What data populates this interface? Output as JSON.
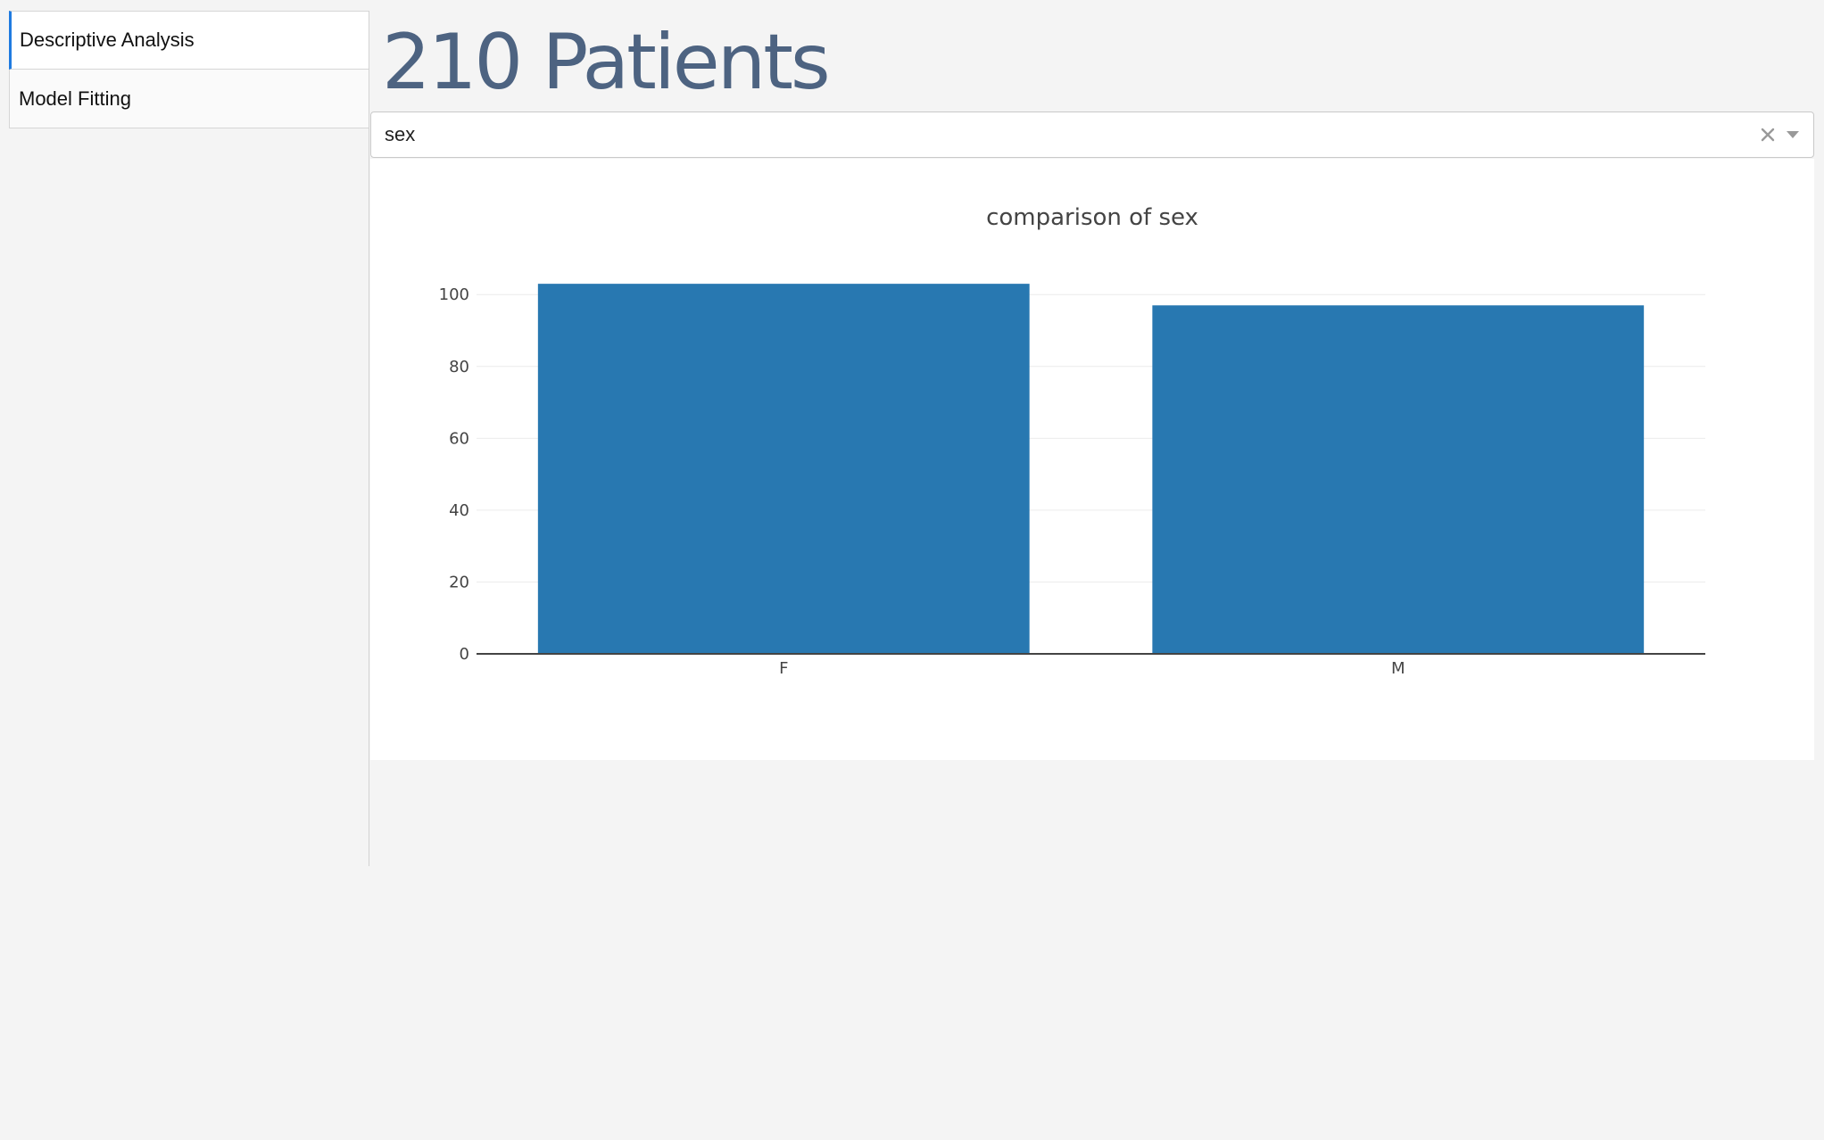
{
  "tabs": [
    {
      "label": "Descriptive Analysis",
      "active": true
    },
    {
      "label": "Model Fitting",
      "active": false
    }
  ],
  "header": {
    "title": "210 Patients"
  },
  "dropdown": {
    "selected": "sex",
    "clear_icon": "close-icon",
    "caret_icon": "chevron-down-icon"
  },
  "colors": {
    "bar": "#2878b1",
    "title": "#4d6381",
    "active_tab_accent": "#1f7be0"
  },
  "chart_data": {
    "type": "bar",
    "title": "comparison of sex",
    "categories": [
      "F",
      "M"
    ],
    "values": [
      103,
      97
    ],
    "xlabel": "",
    "ylabel": "",
    "ylim": [
      0,
      108
    ],
    "yticks": [
      0,
      20,
      40,
      60,
      80,
      100
    ],
    "grid": true
  }
}
